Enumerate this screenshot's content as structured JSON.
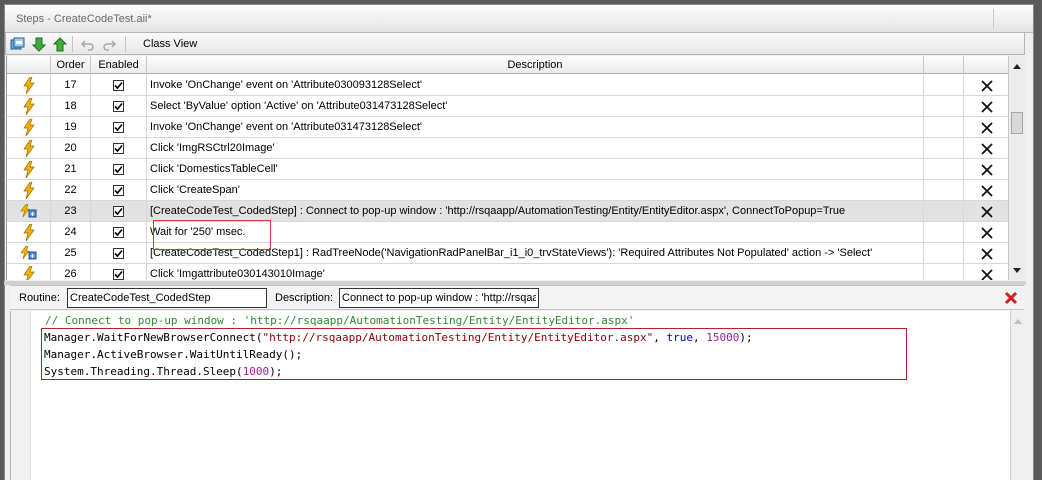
{
  "window": {
    "title": "Steps - CreateCodeTest.aii*"
  },
  "toolbar": {
    "class_view_label": "Class View",
    "icons": [
      "add-step-icon",
      "move-down-icon",
      "move-up-icon",
      "undo-icon",
      "redo-icon"
    ]
  },
  "grid": {
    "columns": {
      "icon": "",
      "order": "Order",
      "enabled": "Enabled",
      "description": "Description"
    },
    "rows": [
      {
        "order": "17",
        "type": "action",
        "description": "Invoke 'OnChange' event on 'Attribute030093128Select'"
      },
      {
        "order": "18",
        "type": "action",
        "description": "Select 'ByValue' option 'Active' on 'Attribute031473128Select'"
      },
      {
        "order": "19",
        "type": "action",
        "description": "Invoke 'OnChange' event on 'Attribute031473128Select'"
      },
      {
        "order": "20",
        "type": "action",
        "description": "Click 'ImgRSCtrl20Image'"
      },
      {
        "order": "21",
        "type": "action",
        "description": "Click 'DomesticsTableCell'"
      },
      {
        "order": "22",
        "type": "action",
        "description": "Click 'CreateSpan'"
      },
      {
        "order": "23",
        "type": "coded",
        "selected": true,
        "description": "[CreateCodeTest_CodedStep] : Connect to pop-up window : 'http://rsqaapp/AutomationTesting/Entity/EntityEditor.aspx', ConnectToPopup=True"
      },
      {
        "order": "24",
        "type": "action",
        "description": "Wait for '250' msec."
      },
      {
        "order": "25",
        "type": "coded",
        "description": "[CreateCodeTest_CodedStep1] : RadTreeNode('NavigationRadPanelBar_i1_i0_trvStateViews'): 'Required Attributes Not Populated' action -> 'Select'"
      },
      {
        "order": "26",
        "type": "action",
        "description": "Click 'Imgattribute030143010Image'"
      }
    ]
  },
  "properties": {
    "routine_label": "Routine:",
    "routine_value": "CreateCodeTest_CodedStep",
    "description_label": "Description:",
    "description_value": "Connect to pop-up window : 'http://rsqaapp/AutomationTesting/Entity/EntityEditor.aspx'"
  },
  "code": {
    "comment": "// Connect to pop-up window : 'http://rsqaapp/AutomationTesting/Entity/EntityEditor.aspx'",
    "l1_a": "Manager.WaitForNewBrowserConnect(",
    "l1_str": "\"http://rsqaapp/AutomationTesting/Entity/EntityEditor.aspx\"",
    "l1_b": ", ",
    "l1_kw": "true",
    "l1_c": ", ",
    "l1_num": "15000",
    "l1_d": ");",
    "l2": "Manager.ActiveBrowser.WaitUntilReady();",
    "l3_a": "System.Threading.Thread.Sleep(",
    "l3_num": "1000",
    "l3_b": ");"
  },
  "colors": {
    "highlight_red": "#e23232",
    "selected_row": "#e2e2e2",
    "lightning": "#f2b200"
  }
}
